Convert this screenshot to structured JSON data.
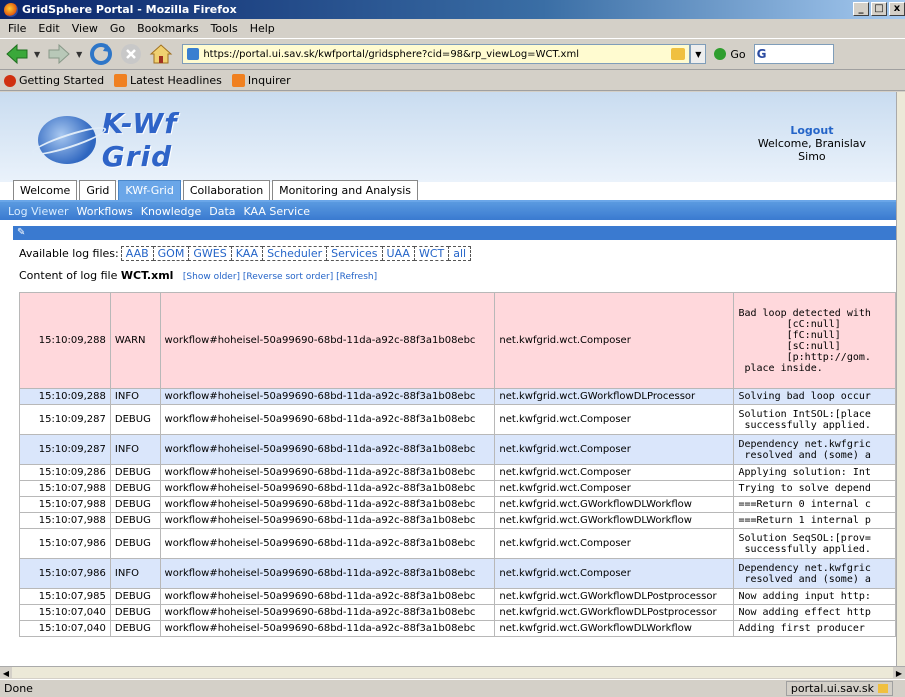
{
  "window": {
    "title": "GridSphere Portal - Mozilla Firefox"
  },
  "menu": [
    "File",
    "Edit",
    "View",
    "Go",
    "Bookmarks",
    "Tools",
    "Help"
  ],
  "nav": {
    "url": "https://portal.ui.sav.sk/kwfportal/gridsphere?cid=98&rp_viewLog=WCT.xml",
    "go_label": "Go",
    "search_value": "G"
  },
  "bookmarks": [
    "Getting Started",
    "Latest Headlines",
    "Inquirer"
  ],
  "portal": {
    "logo_text": "K-Wf Grid",
    "logout": "Logout",
    "welcome": "Welcome, Branislav",
    "user_last": "Simo"
  },
  "tabs": [
    "Welcome",
    "Grid",
    "KWf-Grid",
    "Collaboration",
    "Monitoring and Analysis"
  ],
  "subtabs": [
    "Log Viewer",
    "Workflows",
    "Knowledge",
    "Data",
    "KAA Service"
  ],
  "logviewer": {
    "available_label": "Available log files:",
    "files": [
      "AAB",
      "GOM",
      "GWES",
      "KAA",
      "Scheduler",
      "Services",
      "UAA",
      "WCT",
      "all"
    ],
    "content_label": "Content of log file",
    "current_file": "WCT.xml",
    "actions": "[Show older] [Reverse sort order] [Refresh]"
  },
  "table_rows": [
    {
      "time": "15:10:09,288",
      "level": "WARN",
      "workflow": "workflow#hoheisel-50a99690-68bd-11da-a92c-88f3a1b08ebc",
      "cls": "net.kwfgrid.wct.Composer",
      "msg": "Bad loop detected with\n        [cC:null]\n        [fC:null]\n        [sC:null]\n        [p:http://gom.\n place inside.",
      "kind": "warn"
    },
    {
      "time": "15:10:09,288",
      "level": "INFO",
      "workflow": "workflow#hoheisel-50a99690-68bd-11da-a92c-88f3a1b08ebc",
      "cls": "net.kwfgrid.wct.GWorkflowDLProcessor",
      "msg": "Solving bad loop occur",
      "kind": "info"
    },
    {
      "time": "15:10:09,287",
      "level": "DEBUG",
      "workflow": "workflow#hoheisel-50a99690-68bd-11da-a92c-88f3a1b08ebc",
      "cls": "net.kwfgrid.wct.Composer",
      "msg": "Solution IntSOL:[place\n successfully applied.",
      "kind": "debug"
    },
    {
      "time": "15:10:09,287",
      "level": "INFO",
      "workflow": "workflow#hoheisel-50a99690-68bd-11da-a92c-88f3a1b08ebc",
      "cls": "net.kwfgrid.wct.Composer",
      "msg": "Dependency net.kwfgric\n resolved and (some) a",
      "kind": "info"
    },
    {
      "time": "15:10:09,286",
      "level": "DEBUG",
      "workflow": "workflow#hoheisel-50a99690-68bd-11da-a92c-88f3a1b08ebc",
      "cls": "net.kwfgrid.wct.Composer",
      "msg": "Applying solution: Int",
      "kind": "debug"
    },
    {
      "time": "15:10:07,988",
      "level": "DEBUG",
      "workflow": "workflow#hoheisel-50a99690-68bd-11da-a92c-88f3a1b08ebc",
      "cls": "net.kwfgrid.wct.Composer",
      "msg": "Trying to solve depend",
      "kind": "debug"
    },
    {
      "time": "15:10:07,988",
      "level": "DEBUG",
      "workflow": "workflow#hoheisel-50a99690-68bd-11da-a92c-88f3a1b08ebc",
      "cls": "net.kwfgrid.wct.GWorkflowDLWorkflow",
      "msg": "===Return 0 internal c",
      "kind": "debug"
    },
    {
      "time": "15:10:07,988",
      "level": "DEBUG",
      "workflow": "workflow#hoheisel-50a99690-68bd-11da-a92c-88f3a1b08ebc",
      "cls": "net.kwfgrid.wct.GWorkflowDLWorkflow",
      "msg": "===Return 1 internal p",
      "kind": "debug"
    },
    {
      "time": "15:10:07,986",
      "level": "DEBUG",
      "workflow": "workflow#hoheisel-50a99690-68bd-11da-a92c-88f3a1b08ebc",
      "cls": "net.kwfgrid.wct.Composer",
      "msg": "Solution SeqSOL:[prov=\n successfully applied.",
      "kind": "debug"
    },
    {
      "time": "15:10:07,986",
      "level": "INFO",
      "workflow": "workflow#hoheisel-50a99690-68bd-11da-a92c-88f3a1b08ebc",
      "cls": "net.kwfgrid.wct.Composer",
      "msg": "Dependency net.kwfgric\n resolved and (some) a",
      "kind": "info"
    },
    {
      "time": "15:10:07,985",
      "level": "DEBUG",
      "workflow": "workflow#hoheisel-50a99690-68bd-11da-a92c-88f3a1b08ebc",
      "cls": "net.kwfgrid.wct.GWorkflowDLPostprocessor",
      "msg": "Now adding input http:",
      "kind": "debug"
    },
    {
      "time": "15:10:07,040",
      "level": "DEBUG",
      "workflow": "workflow#hoheisel-50a99690-68bd-11da-a92c-88f3a1b08ebc",
      "cls": "net.kwfgrid.wct.GWorkflowDLPostprocessor",
      "msg": "Now adding effect http",
      "kind": "debug"
    },
    {
      "time": "15:10:07,040",
      "level": "DEBUG",
      "workflow": "workflow#hoheisel-50a99690-68bd-11da-a92c-88f3a1b08ebc",
      "cls": "net.kwfgrid.wct.GWorkflowDLWorkflow",
      "msg": "Adding first producer",
      "kind": "debug"
    }
  ],
  "status": {
    "left": "Done",
    "right": "portal.ui.sav.sk"
  }
}
